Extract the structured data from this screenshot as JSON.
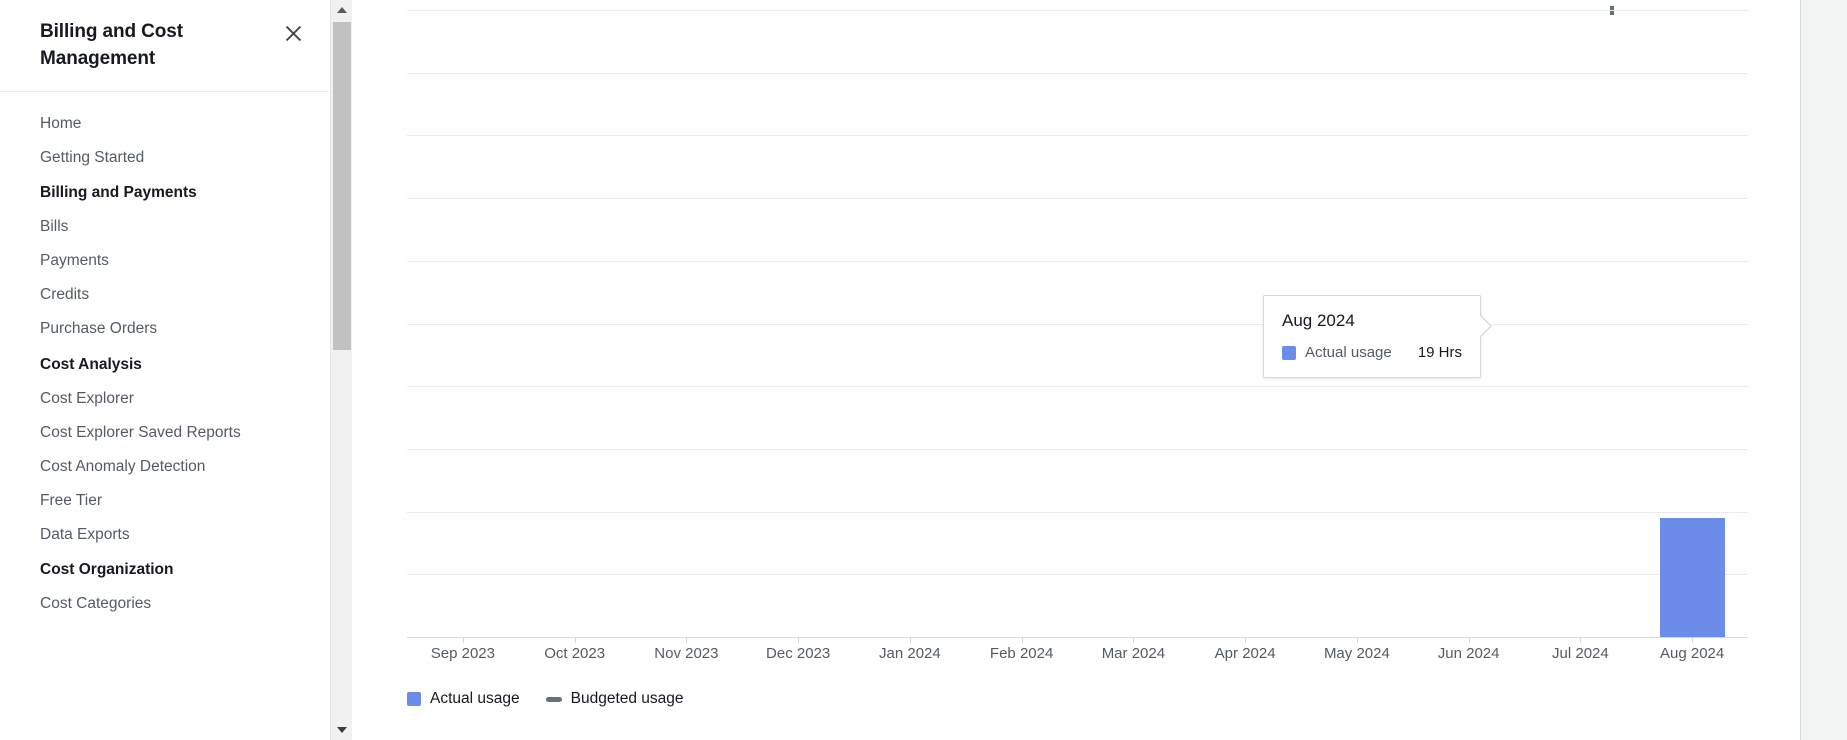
{
  "sidebar": {
    "title": "Billing and Cost Management",
    "close_icon": "close-icon",
    "items": [
      {
        "label": "Home",
        "type": "link"
      },
      {
        "label": "Getting Started",
        "type": "link"
      },
      {
        "label": "Billing and Payments",
        "type": "heading"
      },
      {
        "label": "Bills",
        "type": "link"
      },
      {
        "label": "Payments",
        "type": "link"
      },
      {
        "label": "Credits",
        "type": "link"
      },
      {
        "label": "Purchase Orders",
        "type": "link"
      },
      {
        "label": "Cost Analysis",
        "type": "heading"
      },
      {
        "label": "Cost Explorer",
        "type": "link"
      },
      {
        "label": "Cost Explorer Saved Reports",
        "type": "link"
      },
      {
        "label": "Cost Anomaly Detection",
        "type": "link"
      },
      {
        "label": "Free Tier",
        "type": "link"
      },
      {
        "label": "Data Exports",
        "type": "link"
      },
      {
        "label": "Cost Organization",
        "type": "heading"
      },
      {
        "label": "Cost Categories",
        "type": "link"
      }
    ]
  },
  "scrollbar": {
    "up_arrow_icon": "chevron-up-icon",
    "down_arrow_icon": "chevron-down-icon"
  },
  "tooltip": {
    "title": "Aug 2024",
    "series_label": "Actual usage",
    "value": "19 Hrs",
    "swatch_color": "#6b8ce8"
  },
  "colors": {
    "actual_usage": "#6b8ce8",
    "budgeted_usage": "#687078",
    "gridline": "#e9ebed",
    "axis_text": "#545b64"
  },
  "chart_data": {
    "type": "bar",
    "title": "",
    "xlabel": "",
    "ylabel": "",
    "ylim": [
      0,
      100
    ],
    "yticks": [
      0,
      10,
      20,
      30,
      40,
      50,
      60,
      70,
      80,
      90,
      100
    ],
    "grid": true,
    "legend_position": "bottom-left",
    "categories": [
      "Sep 2023",
      "Oct 2023",
      "Nov 2023",
      "Dec 2023",
      "Jan 2024",
      "Feb 2024",
      "Mar 2024",
      "Apr 2024",
      "May 2024",
      "Jun 2024",
      "Jul 2024",
      "Aug 2024"
    ],
    "series": [
      {
        "name": "Actual usage",
        "color": "#6b8ce8",
        "unit": "Hrs",
        "values": [
          0,
          0,
          0,
          0,
          0,
          0,
          0,
          0,
          0,
          0,
          0,
          19
        ]
      },
      {
        "name": "Budgeted usage",
        "color": "#687078",
        "unit": "Hrs",
        "values": [
          null,
          null,
          null,
          null,
          null,
          null,
          null,
          null,
          null,
          null,
          null,
          null
        ]
      }
    ],
    "legend": [
      {
        "label": "Actual usage",
        "marker": "square",
        "color": "#6b8ce8"
      },
      {
        "label": "Budgeted usage",
        "marker": "dash",
        "color": "#687078"
      }
    ]
  }
}
